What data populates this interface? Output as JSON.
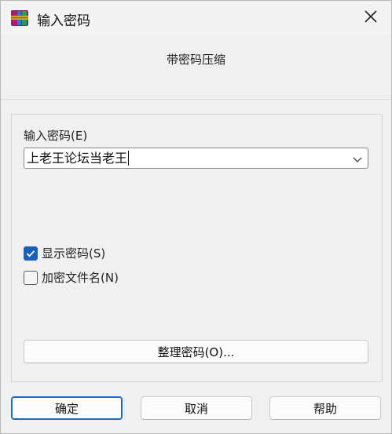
{
  "window": {
    "title": "输入密码",
    "icon": "winrar-books-icon",
    "close_icon": "close-icon"
  },
  "subtitle": "带密码压缩",
  "password": {
    "label": "输入密码(E)",
    "value": "上老王论坛当老王"
  },
  "options": {
    "show_password": {
      "label": "显示密码(S)",
      "checked": true
    },
    "encrypt_filenames": {
      "label": "加密文件名(N)",
      "checked": false
    }
  },
  "organize_button": "整理密码(O)...",
  "footer": {
    "ok": "确定",
    "cancel": "取消",
    "help": "帮助"
  },
  "colors": {
    "accent": "#1a60b8",
    "background": "#f0f0f0"
  }
}
